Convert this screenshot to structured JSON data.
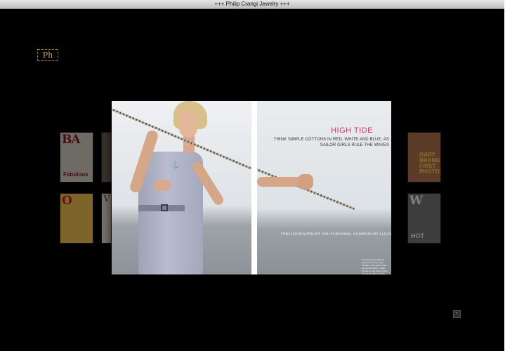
{
  "window": {
    "title": "+++ Philip Crangi Jewelry +++"
  },
  "logo": {
    "text": "Ph"
  },
  "thumbnails_left": [
    {
      "masthead": "BA",
      "cover_line": "Fabulous",
      "bg": "#c9c2b7",
      "color": "#7e1d2a"
    },
    {
      "masthead": "O",
      "cover_line": "",
      "bg": "#e5b64a",
      "color": "#b22330"
    },
    {
      "masthead": "V",
      "cover_line": "",
      "bg": "#d9cdbd",
      "color": "#7a6c58"
    }
  ],
  "thumbnails_right": [
    {
      "masthead": "",
      "cover_line": "GARY BRANGE FIRST PHOTOS",
      "bg": "#a86c4c",
      "color": "#f0d24a"
    },
    {
      "masthead": "W",
      "cover_line": "HOT",
      "bg": "#6f6f6f",
      "color": "#e8e8e8"
    }
  ],
  "spread": {
    "headline": "HIGH TIDE",
    "subhead": "THINK SIMPLE COTTONS IN RED, WHITE AND BLUE, AS SAILOR GIRLS RULE THE WAVES",
    "credit": "PHOTOGRAPHS BY VIKI FORSHEE. FASHION BY LUCIE MCCUL",
    "caption": "Cotton dress $1,015, by Stella McCartney. Gold necklace with rubber bead pendant $1,925 by Philip Crangi at Fred Segal. Gold bracelet $1,500 by Philip Crangi."
  },
  "controls": {
    "nav_button": "+"
  },
  "colors": {
    "headline": "#d23a5a",
    "logo_gold": "#c8a865",
    "stage_bg": "#000000"
  }
}
